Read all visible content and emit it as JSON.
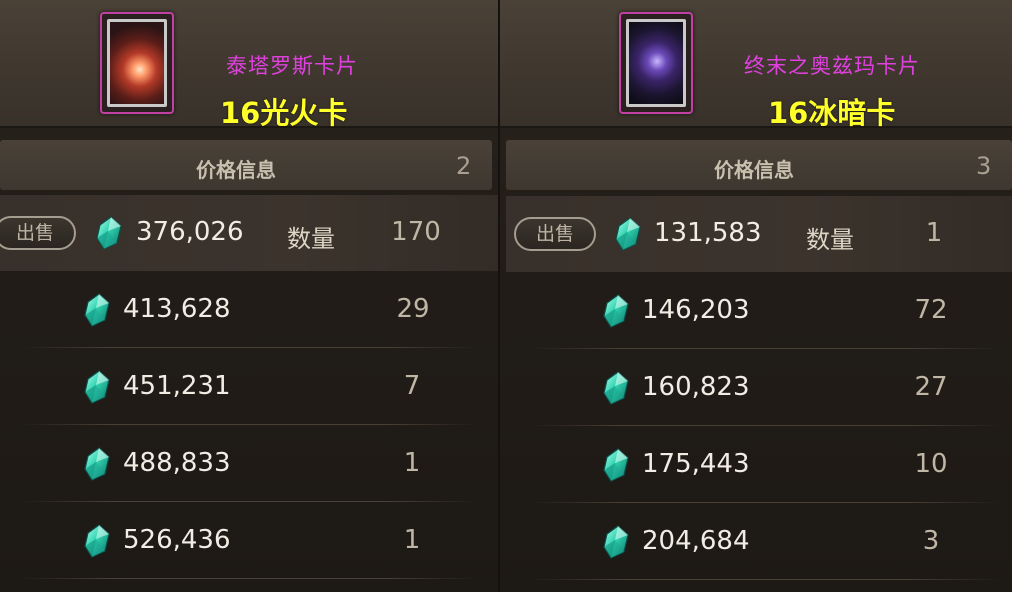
{
  "panels": [
    {
      "card_name": "泰塔罗斯卡片",
      "card_tag": "16光火卡",
      "price_header_title": "价格信息",
      "price_header_count": "2",
      "sell_label": "出售",
      "qty_label": "数量",
      "listings": [
        {
          "price": "376,026",
          "qty": "170"
        },
        {
          "price": "413,628",
          "qty": "29"
        },
        {
          "price": "451,231",
          "qty": "7"
        },
        {
          "price": "488,833",
          "qty": "1"
        },
        {
          "price": "526,436",
          "qty": "1"
        }
      ]
    },
    {
      "card_name": "终末之奥兹玛卡片",
      "card_tag": "16冰暗卡",
      "price_header_title": "价格信息",
      "price_header_count": "3",
      "sell_label": "出售",
      "qty_label": "数量",
      "listings": [
        {
          "price": "131,583",
          "qty": "1"
        },
        {
          "price": "146,203",
          "qty": "72"
        },
        {
          "price": "160,823",
          "qty": "27"
        },
        {
          "price": "175,443",
          "qty": "10"
        },
        {
          "price": "204,684",
          "qty": "3"
        }
      ]
    }
  ],
  "icons": {
    "currency": "gem-icon",
    "card_left": "fire-card-art",
    "card_right": "dark-card-art"
  },
  "colors": {
    "card_name": "#e040e0",
    "card_tag": "#ffff2a",
    "card_frame": "#c23fa4",
    "gem": "#2fd3b0"
  }
}
